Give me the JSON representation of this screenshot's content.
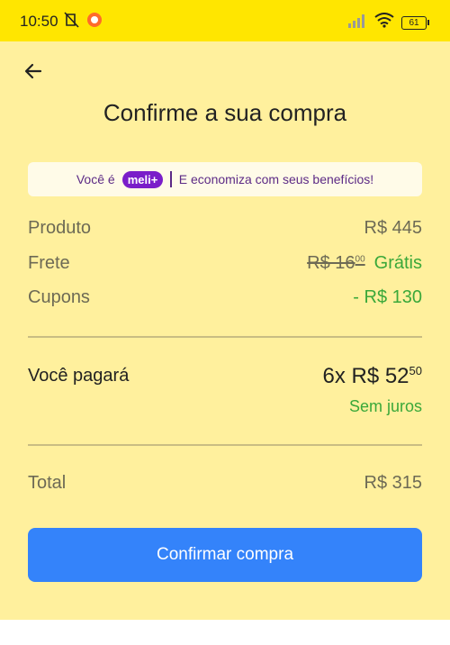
{
  "status": {
    "time": "10:50",
    "battery": "61"
  },
  "header": {
    "title": "Confirme a sua compra"
  },
  "banner": {
    "prefix": "Você é",
    "badge": "meli+",
    "text": "E economiza com seus benefícios!"
  },
  "summary": {
    "produto_label": "Produto",
    "produto_value": "R$ 445",
    "frete_label": "Frete",
    "frete_old": "R$ 16",
    "frete_old_cents": "00",
    "frete_value": "Grátis",
    "cupons_label": "Cupons",
    "cupons_value": "- R$ 130"
  },
  "payment": {
    "label": "Você pagará",
    "value": "6x R$ 52",
    "value_cents": "50",
    "note": "Sem juros"
  },
  "total": {
    "label": "Total",
    "value": "R$ 315"
  },
  "actions": {
    "confirm": "Confirmar compra"
  },
  "colors": {
    "statusbar": "#ffe600",
    "background": "#fff09d",
    "button": "#3483fa",
    "green": "#3aa83a",
    "meli_purple": "#7a1ec9"
  }
}
